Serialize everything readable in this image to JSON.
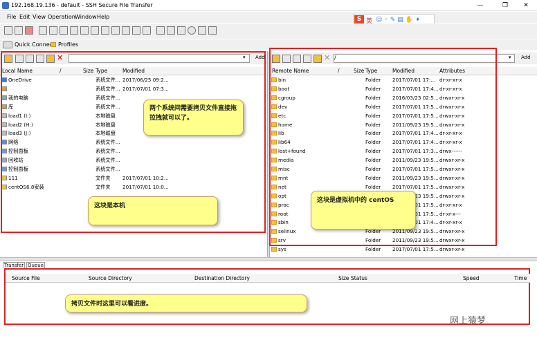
{
  "window": {
    "title": "192.168.19.136 - default - SSH Secure File Transfer",
    "min": "—",
    "max": "❐",
    "close": "✕"
  },
  "menu": [
    "File",
    "Edit",
    "View",
    "Operation",
    "Window",
    "Help"
  ],
  "ime": {
    "logo": "S",
    "lang": "英"
  },
  "connect": {
    "quick_connect": "Quick Connect",
    "profiles": "Profiles"
  },
  "local": {
    "path": "",
    "add": "Add",
    "headers": {
      "name": "Local Name",
      "slash": "/",
      "size": "Size",
      "type": "Type",
      "modified": "Modified"
    },
    "rows": [
      {
        "name": "OneDrive",
        "size": "",
        "type": "系统文件...",
        "modified": "2017/06/25 09:2...",
        "icon": "cloud"
      },
      {
        "name": "",
        "size": "",
        "type": "系统文件...",
        "modified": "2017/07/01 07:3...",
        "icon": "user"
      },
      {
        "name": "我的电脑",
        "size": "",
        "type": "系统文件...",
        "modified": "",
        "icon": "pc"
      },
      {
        "name": "库",
        "size": "",
        "type": "系统文件...",
        "modified": "",
        "icon": "lib"
      },
      {
        "name": "load1 (I:)",
        "size": "",
        "type": "本地磁盘",
        "modified": "",
        "icon": "drive"
      },
      {
        "name": "load2 (H:)",
        "size": "",
        "type": "本地磁盘",
        "modified": "",
        "icon": "drive"
      },
      {
        "name": "load3 (J:)",
        "size": "",
        "type": "本地磁盘",
        "modified": "",
        "icon": "drive"
      },
      {
        "name": "网络",
        "size": "",
        "type": "系统文件...",
        "modified": "",
        "icon": "net"
      },
      {
        "name": "控制面板",
        "size": "",
        "type": "系统文件...",
        "modified": "",
        "icon": "cp"
      },
      {
        "name": "回收站",
        "size": "",
        "type": "系统文件...",
        "modified": "",
        "icon": "bin"
      },
      {
        "name": "控制面板",
        "size": "",
        "type": "系统文件...",
        "modified": "",
        "icon": "cp"
      },
      {
        "name": "111",
        "size": "",
        "type": "文件夹",
        "modified": "2017/07/01 10:2...",
        "icon": "folder"
      },
      {
        "name": "centOS6.8安装",
        "size": "",
        "type": "文件夹",
        "modified": "2017/07/01 10:0...",
        "icon": "folder"
      }
    ]
  },
  "remote": {
    "path": "/",
    "add": "Add",
    "headers": {
      "name": "Remote Name",
      "slash": "/",
      "size": "Size",
      "type": "Type",
      "modified": "Modified",
      "attributes": "Attributes"
    },
    "rows": [
      {
        "name": "bin",
        "type": "Folder",
        "modified": "2017/07/01 17:...",
        "attr": "dr-xr-xr-x"
      },
      {
        "name": "boot",
        "type": "Folder",
        "modified": "2017/07/01 17:4...",
        "attr": "dr-xr-xr-x"
      },
      {
        "name": "cgroup",
        "type": "Folder",
        "modified": "2016/03/23 02:5...",
        "attr": "drwxr-xr-x"
      },
      {
        "name": "dev",
        "type": "Folder",
        "modified": "2017/07/01 17:5...",
        "attr": "drwxr-xr-x"
      },
      {
        "name": "etc",
        "type": "Folder",
        "modified": "2017/07/01 17:5...",
        "attr": "drwxr-xr-x"
      },
      {
        "name": "home",
        "type": "Folder",
        "modified": "2011/09/23 19:5...",
        "attr": "drwxr-xr-x"
      },
      {
        "name": "lib",
        "type": "Folder",
        "modified": "2017/07/01 17:4...",
        "attr": "dr-xr-xr-x"
      },
      {
        "name": "lib64",
        "type": "Folder",
        "modified": "2017/07/01 17:4...",
        "attr": "dr-xr-xr-x"
      },
      {
        "name": "lost+found",
        "type": "Folder",
        "modified": "2017/07/01 17:3...",
        "attr": "drwx------"
      },
      {
        "name": "media",
        "type": "Folder",
        "modified": "2011/09/23 19:5...",
        "attr": "drwxr-xr-x"
      },
      {
        "name": "misc",
        "type": "Folder",
        "modified": "2017/07/01 17:5...",
        "attr": "drwxr-xr-x"
      },
      {
        "name": "mnt",
        "type": "Folder",
        "modified": "2011/09/23 19:5...",
        "attr": "drwxr-xr-x"
      },
      {
        "name": "net",
        "type": "Folder",
        "modified": "2017/07/01 17:5...",
        "attr": "drwxr-xr-x"
      },
      {
        "name": "opt",
        "type": "Folder",
        "modified": "2011/09/23 19:5...",
        "attr": "drwxr-xr-x"
      },
      {
        "name": "proc",
        "type": "Folder",
        "modified": "2017/07/01 17:5...",
        "attr": "dr-xr-xr-x"
      },
      {
        "name": "root",
        "type": "Folder",
        "modified": "2017/07/01 17:5...",
        "attr": "dr-xr-x---"
      },
      {
        "name": "sbin",
        "type": "Folder",
        "modified": "2017/07/01 17:4...",
        "attr": "dr-xr-xr-x"
      },
      {
        "name": "selinux",
        "type": "Folder",
        "modified": "2011/09/23 19:5...",
        "attr": "drwxr-xr-x"
      },
      {
        "name": "srv",
        "type": "Folder",
        "modified": "2011/09/23 19:5...",
        "attr": "drwxr-xr-x"
      },
      {
        "name": "sys",
        "type": "Folder",
        "modified": "2017/07/01 17:5...",
        "attr": "drwxr-xr-x"
      }
    ]
  },
  "queue": {
    "tabs": [
      "Transfer",
      "Queue"
    ],
    "headers": {
      "source_file": "Source File",
      "source_dir": "Source Directory",
      "dest_dir": "Destination Directory",
      "size": "Size",
      "status": "Status",
      "speed": "Speed",
      "time": "Time"
    }
  },
  "notes": {
    "drag": "两个系统间需要拷贝文件直接拖拉拽就可以了。",
    "local": "这块是本机",
    "remote": "这块是虚拟机中的 centOS",
    "progress": "拷贝文件时这里可以看进度。"
  },
  "watermark": "网上猿梦",
  "colors": {
    "annotation_border": "#dd2222",
    "note_bg": "#ffff8c",
    "folder": "#f0c040"
  }
}
